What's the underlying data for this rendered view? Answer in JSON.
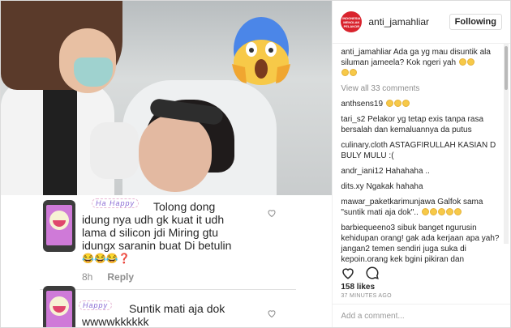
{
  "media": {
    "comment1": {
      "banner": "Ha Happy",
      "lines": [
        "Tolong dong",
        "idung nya udh gk kuat it udh",
        "lama d silicon jdi Miring gtu",
        "idungx saranin buat Di betulin"
      ],
      "emoji": "😂😂😂❓",
      "time": "8h",
      "reply": "Reply"
    },
    "comment2": {
      "banner": "Happy",
      "lines": [
        "Suntik mati aja dok",
        "wwwwkkkkkk"
      ]
    }
  },
  "post": {
    "username": "anti_jamahliar",
    "avatar_text": "INDONESIA MENOLAK PELAKOR",
    "follow_label": "Following",
    "caption_user": "anti_jamahliar",
    "caption_text": "Ada ga yg mau disuntik ala siluman jameela? Kok ngeri yah",
    "view_all": "View all 33 comments",
    "comments": [
      {
        "user": "anthsens19",
        "text": ""
      },
      {
        "user": "tari_s2",
        "text": "Pelakor yg tetap exis tanpa rasa bersalah dan kemaluannya da putus"
      },
      {
        "user": "culinary.cloth",
        "text": "ASTAGFIRULLAH KASIAN D BULY MULU :("
      },
      {
        "user": "andr_iani12",
        "text": "Hahahaha .."
      },
      {
        "user": "dits.xy",
        "text": "Ngakak hahaha"
      },
      {
        "user": "mawar_paketkarimunjawa",
        "text": "Galfok sama \"suntik mati aja dok\".."
      },
      {
        "user": "barbiequeeno3",
        "text": "sibuk banget ngurusin kehidupan orang! gak ada kerjaan apa yah? jangan2 temen sendiri juga suka di kepoin.orang kek bgini pikiran dan"
      }
    ],
    "likes": "158 likes",
    "time": "37 MINUTES AGO",
    "add_comment_placeholder": "Add a comment..."
  },
  "colors": {
    "accent": "#d9232d",
    "meta": "#8e8e8e",
    "banner": "#8a6bd4"
  },
  "icons": [
    "heart-icon",
    "comment-bubble-icon",
    "screaming-face-emoji",
    "phone-smile-icon"
  ]
}
